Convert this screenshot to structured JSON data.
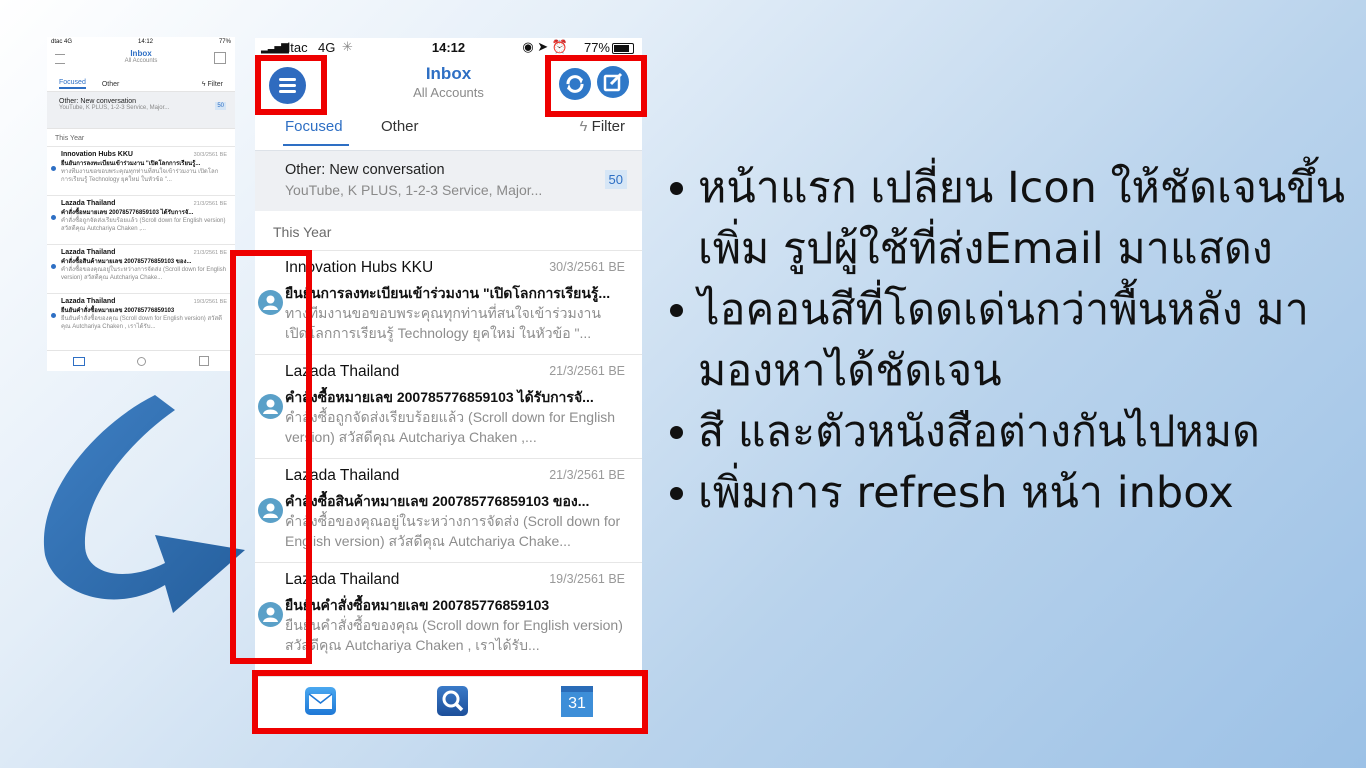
{
  "small_phone": {
    "status": {
      "carrier": "dtac  4G",
      "time": "14:12",
      "battery": "77%"
    },
    "title": "Inbox",
    "subtitle": "All Accounts",
    "tabs": {
      "focused": "Focused",
      "other": "Other",
      "filter": "Filter"
    },
    "other_banner": {
      "title": "Other: New conversation",
      "preview": "YouTube, K PLUS, 1-2-3 Service, Major...",
      "count": "50"
    },
    "section": "This Year",
    "messages": [
      {
        "sender": "Innovation Hubs KKU",
        "date": "30/3/2561 BE",
        "subject": "ยืนยันการลงทะเบียนเข้าร่วมงาน \"เปิดโลกการเรียนรู้...",
        "preview": "ทางทีมงานขอขอบพระคุณทุกท่านที่สนใจเข้าร่วมงาน เปิดโลกการเรียนรู้ Technology ยุคใหม่ ในหัวข้อ \"..."
      },
      {
        "sender": "Lazada Thailand",
        "date": "21/3/2561 BE",
        "subject": "คำสั่งซื้อหมายเลข 200785776859103 ได้รับการจั...",
        "preview": "คำสั่งซื้อถูกจัดส่งเรียบร้อยแล้ว (Scroll down for English version) สวัสดีคุณ Autchariya Chaken ,..."
      },
      {
        "sender": "Lazada Thailand",
        "date": "21/3/2561 BE",
        "subject": "คำสั่งซื้อสินค้าหมายเลข 200785776859103 ของ...",
        "preview": "คำสั่งซื้อของคุณอยู่ในระหว่างการจัดส่ง (Scroll down for English version) สวัสดีคุณ Autchariya Chake..."
      },
      {
        "sender": "Lazada Thailand",
        "date": "19/3/2561 BE",
        "subject": "ยืนยันคำสั่งซื้อหมายเลข 200785776859103",
        "preview": "ยืนยันคำสั่งซื้อของคุณ (Scroll down for English version) สวัสดีคุณ Autchariya Chaken , เราได้รับ..."
      }
    ]
  },
  "big_phone": {
    "status": {
      "carrier": "dtac",
      "network": "4G",
      "time": "14:12",
      "battery": "77%"
    },
    "title": "Inbox",
    "subtitle": "All Accounts",
    "tabs": {
      "focused": "Focused",
      "other": "Other",
      "filter": "Filter"
    },
    "other_banner": {
      "title": "Other: New conversation",
      "preview": "YouTube, K PLUS, 1-2-3 Service, Major...",
      "count": "50"
    },
    "section": "This Year",
    "messages": [
      {
        "sender": "Innovation Hubs KKU",
        "date": "30/3/2561 BE",
        "subject": "ยืนยันการลงทะเบียนเข้าร่วมงาน \"เปิดโลกการเรียนรู้...",
        "preview": "ทางทีมงานขอขอบพระคุณทุกท่านที่สนใจเข้าร่วมงาน เปิดโลกการเรียนรู้ Technology ยุคใหม่ ในหัวข้อ \"..."
      },
      {
        "sender": "Lazada Thailand",
        "date": "21/3/2561 BE",
        "subject": "คำสั่งซื้อหมายเลข 200785776859103 ได้รับการจั...",
        "preview": "คำสั่งซื้อถูกจัดส่งเรียบร้อยแล้ว (Scroll down for English version) สวัสดีคุณ Autchariya Chaken ,..."
      },
      {
        "sender": "Lazada Thailand",
        "date": "21/3/2561 BE",
        "subject": "คำสั่งซื้อสินค้าหมายเลข 200785776859103 ของ...",
        "preview": "คำสั่งซื้อของคุณอยู่ในระหว่างการจัดส่ง (Scroll down for English version) สวัสดีคุณ Autchariya Chake..."
      },
      {
        "sender": "Lazada Thailand",
        "date": "19/3/2561 BE",
        "subject": "ยืนยันคำสั่งซื้อหมายเลข 200785776859103",
        "preview": "ยืนยันคำสั่งซื้อของคุณ (Scroll down for English version) สวัสดีคุณ Autchariya Chaken , เราได้รับ..."
      }
    ],
    "calendar_day": "31"
  },
  "bullets": [
    "หน้าแรก เปลี่ยน Icon ให้ชัดเจนขึ้น",
    "เพิ่ม รูปผู้ใช้ที่ส่งEmail มาแสดง",
    "ไอคอนสีที่โดดเด่นกว่าพื้นหลัง มา",
    "มองหาได้ชัดเจน",
    "สี และตัวหนังสือต่างกันไปหมด",
    "เพิ่มการ refresh หน้า inbox"
  ],
  "colors": {
    "accent": "#2e6fc4",
    "highlight": "#ee0000",
    "arrow": "#2f6fb3"
  }
}
